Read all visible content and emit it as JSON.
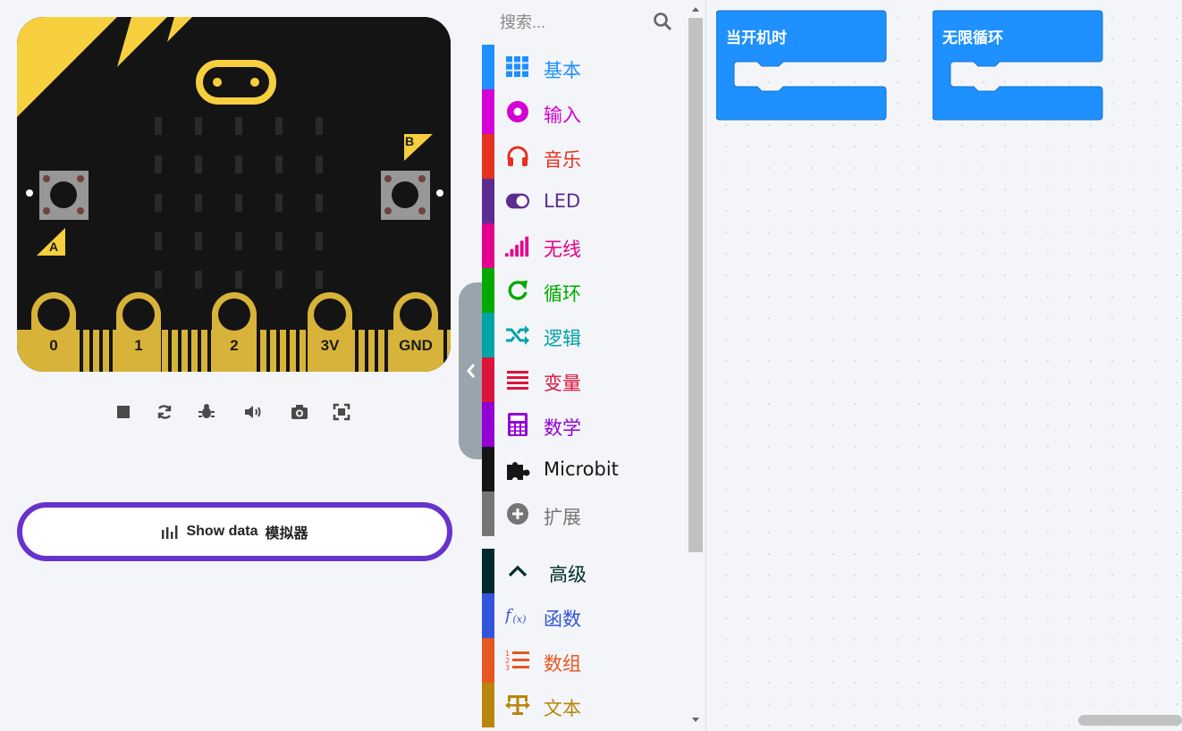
{
  "simulator": {
    "pins": [
      "0",
      "1",
      "2",
      "3V",
      "GND"
    ],
    "button_a": "A",
    "button_b": "B",
    "toolbar": [
      "stop-icon",
      "restart-icon",
      "debug-icon",
      "mute-icon",
      "screenshot-icon",
      "fullscreen-icon"
    ],
    "show_data": {
      "label": "Show data",
      "suffix": "模拟器"
    }
  },
  "toolbox": {
    "search_placeholder": "搜索...",
    "categories": [
      {
        "label": "基本",
        "color": "#1e90ff",
        "icon": "grid-icon"
      },
      {
        "label": "输入",
        "color": "#d400d4",
        "icon": "circle-dot-icon"
      },
      {
        "label": "音乐",
        "color": "#e63022",
        "icon": "headphones-icon"
      },
      {
        "label": "LED",
        "color": "#5c2d91",
        "icon": "toggle-icon"
      },
      {
        "label": "无线",
        "color": "#e3008c",
        "icon": "signal-bars-icon"
      },
      {
        "label": "循环",
        "color": "#00aa00",
        "icon": "refresh-icon"
      },
      {
        "label": "逻辑",
        "color": "#00a4a6",
        "icon": "shuffle-icon"
      },
      {
        "label": "变量",
        "color": "#dc143c",
        "icon": "list-lines-icon"
      },
      {
        "label": "数学",
        "color": "#9400d3",
        "icon": "calculator-icon"
      },
      {
        "label": "Microbit",
        "color": "#151515",
        "icon": "puzzle-icon"
      },
      {
        "label": "扩展",
        "color": "#757575",
        "icon": "plus-circle-icon"
      }
    ],
    "advanced": {
      "label": "高级",
      "color": "#022a2a",
      "icon": "chevron-up-icon"
    },
    "advanced_categories": [
      {
        "label": "函数",
        "color": "#3455db",
        "icon": "function-icon"
      },
      {
        "label": "数组",
        "color": "#e65722",
        "icon": "numbered-list-icon"
      },
      {
        "label": "文本",
        "color": "#b8860b",
        "icon": "text-icon"
      }
    ]
  },
  "workspace": {
    "blocks": [
      {
        "label": "当开机时",
        "color": "#1e90ff"
      },
      {
        "label": "无限循环",
        "color": "#1e90ff"
      }
    ]
  }
}
